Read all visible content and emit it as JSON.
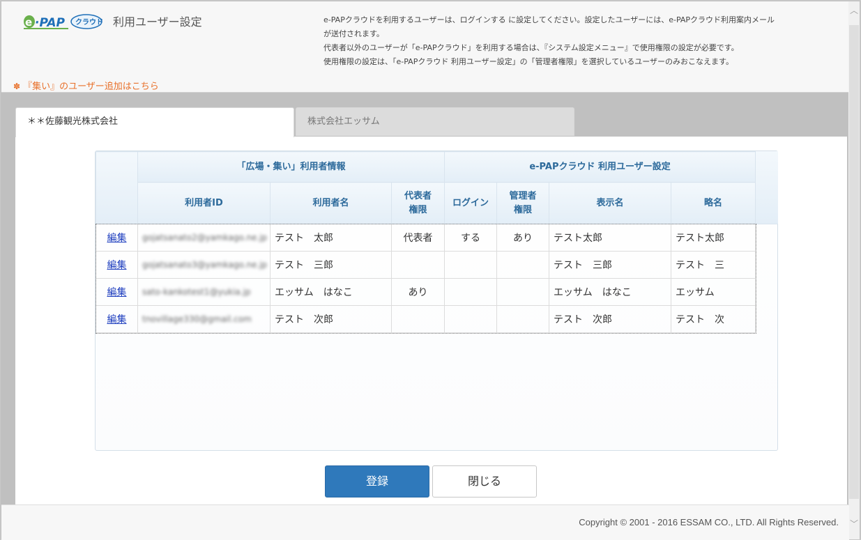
{
  "header": {
    "logo_text": "e-PAP クラウド",
    "title": "利用ユーザー設定",
    "notice_lines": [
      "e-PAPクラウドを利用するユーザーは、ログインする に設定してください。設定したユーザーには、e-PAPクラウド利用案内メール",
      "が送付されます。",
      "代表者以外のユーザーが「e-PAPクラウド」を利用する場合は、『システム設定メニュー』で使用権限の設定が必要です。",
      "使用権限の設定は、「e-PAPクラウド 利用ユーザー設定」の「管理者権限」を選択しているユーザーのみおこなえます。"
    ],
    "add_user_link": "『集い』のユーザー追加はこちら"
  },
  "tabs": [
    {
      "label": "＊＊佐藤観光株式会社",
      "active": true
    },
    {
      "label": "株式会社エッサム",
      "active": false
    }
  ],
  "table": {
    "group_headers": {
      "left": "「広場・集い」利用者情報",
      "right": "e-PAPクラウド 利用ユーザー設定"
    },
    "columns": {
      "user_id": "利用者ID",
      "user_name": "利用者名",
      "rep_line1": "代表者",
      "rep_line2": "権限",
      "login": "ログイン",
      "admin_line1": "管理者",
      "admin_line2": "権限",
      "display_name": "表示名",
      "short_name": "略名"
    },
    "edit_label": "編集",
    "rows": [
      {
        "user_id": "gojatsanato2@yamkago.ne.jp",
        "user_name": "テスト　太郎",
        "rep": "代表者",
        "login": "する",
        "admin": "あり",
        "display_name": "テスト太郎",
        "short_name": "テスト太郎"
      },
      {
        "user_id": "gojatsanato3@yamkago.ne.jp",
        "user_name": "テスト　三郎",
        "rep": "",
        "login": "",
        "admin": "",
        "display_name": "テスト　三郎",
        "short_name": "テスト　三"
      },
      {
        "user_id": "sato-kankotest1@yukia.jp",
        "user_name": "エッサム　はなこ",
        "rep": "あり",
        "login": "",
        "admin": "",
        "display_name": "エッサム　はなこ",
        "short_name": "エッサム"
      },
      {
        "user_id": "tnovillage330@gmail.com",
        "user_name": "テスト　次郎",
        "rep": "",
        "login": "",
        "admin": "",
        "display_name": "テスト　次郎",
        "short_name": "テスト　次"
      }
    ]
  },
  "buttons": {
    "register": "登録",
    "close": "閉じる"
  },
  "footer": {
    "copyright": "Copyright © 2001 - 2016 ESSAM CO., LTD. All Rights Reserved."
  },
  "colors": {
    "primary_button": "#2f79bb",
    "header_text": "#2d6a9b",
    "link_orange": "#e8702a",
    "edit_link": "#1f3fbf"
  }
}
